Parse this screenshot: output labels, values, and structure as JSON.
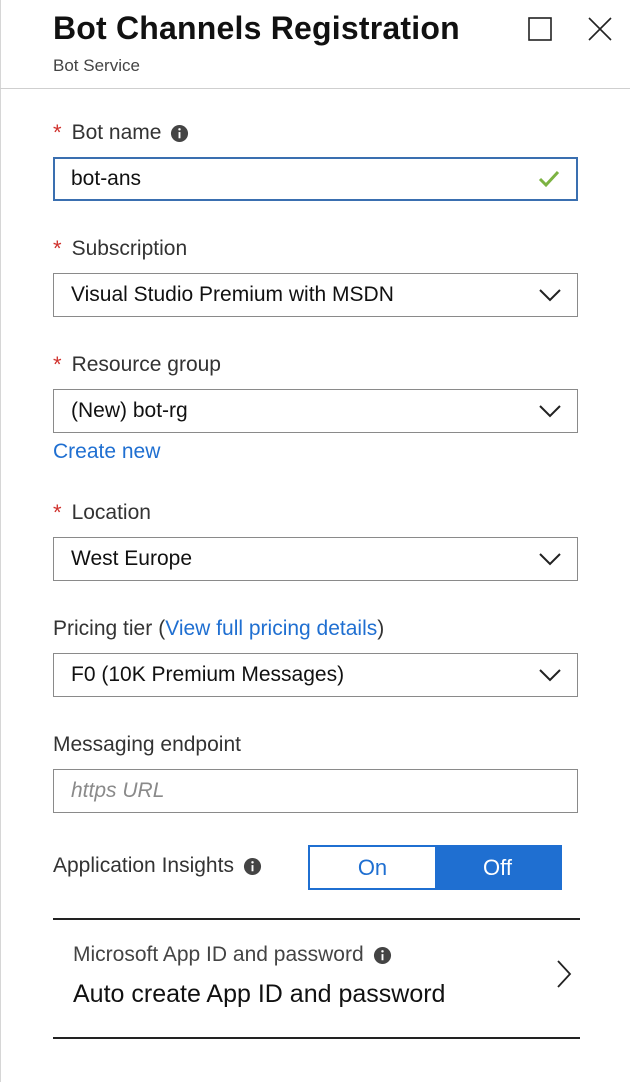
{
  "header": {
    "title": "Bot Channels Registration",
    "subtitle": "Bot Service",
    "icons": {
      "maximize": "maximize-icon",
      "close": "close-icon"
    }
  },
  "form": {
    "required_marker": "*",
    "bot_name": {
      "label": "Bot name",
      "value": "bot-ans",
      "valid": true,
      "icon": "info-icon"
    },
    "subscription": {
      "label": "Subscription",
      "value": "Visual Studio Premium with MSDN"
    },
    "resource_group": {
      "label": "Resource group",
      "value": "(New) bot-rg",
      "create_new": "Create new"
    },
    "location": {
      "label": "Location",
      "value": "West Europe"
    },
    "pricing_tier": {
      "label": "Pricing tier",
      "paren_open": "(",
      "link": "View full pricing details",
      "paren_close": ")",
      "value": "F0 (10K Premium Messages)"
    },
    "messaging_endpoint": {
      "label": "Messaging endpoint",
      "placeholder": "https URL",
      "value": ""
    },
    "application_insights": {
      "label": "Application Insights",
      "on": "On",
      "off": "Off",
      "selected": "Off"
    },
    "app_id": {
      "label": "Microsoft App ID and password",
      "value": "Auto create App ID and password"
    }
  },
  "colors": {
    "accent": "#1f6fd1",
    "required": "#d0312d",
    "valid_check": "#7cb342",
    "focus_border": "#3a6fb0"
  }
}
